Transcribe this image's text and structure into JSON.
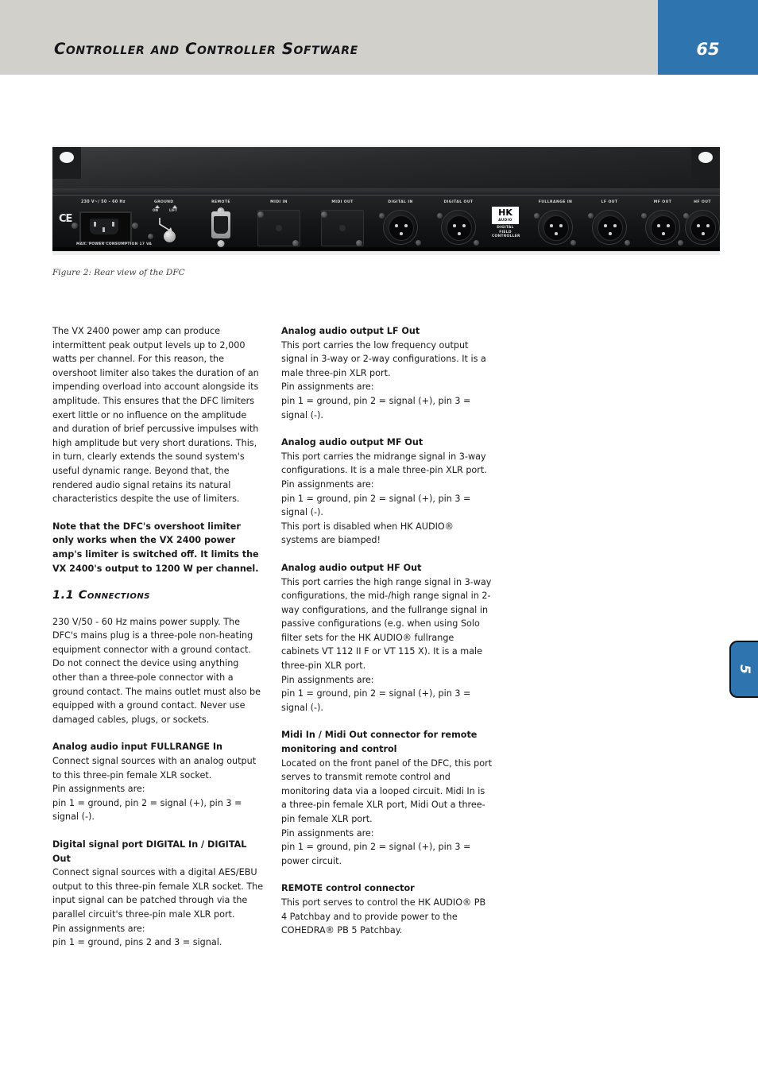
{
  "header": {
    "title": "Controller and Controller Software",
    "page_number": "65",
    "side_tab_label": "5",
    "accent_color": "#2e74af",
    "bar_color": "#d2d0cb"
  },
  "figure": {
    "caption": "Figure 2: Rear view of the DFC",
    "device": {
      "ce_mark": "CE",
      "mains_label": "230 V~/ 50 – 60 Hz",
      "consumption_label": "MAX. POWER CONSUMPTION 17 VA",
      "ground_label": "GROUND",
      "ground_option_on": "ON",
      "ground_option_lift": "LIFT",
      "brand_mark": "HK",
      "brand_mark_sub": "AUDIO",
      "brand_caption_line1": "DIGITAL",
      "brand_caption_line2": "FIELD",
      "brand_caption_line3": "CONTROLLER",
      "ports": [
        {
          "label": "REMOTE",
          "type": "dsub"
        },
        {
          "label": "MIDI IN",
          "type": "blank-plate"
        },
        {
          "label": "MIDI OUT",
          "type": "blank-plate"
        },
        {
          "label": "DIGITAL IN",
          "type": "xlr-female"
        },
        {
          "label": "DIGITAL OUT",
          "type": "xlr-male"
        },
        {
          "label": "FULLRANGE IN",
          "type": "xlr-female"
        },
        {
          "label": "LF OUT",
          "type": "xlr-male"
        },
        {
          "label": "MF OUT",
          "type": "xlr-male"
        },
        {
          "label": "HF OUT",
          "type": "xlr-male"
        }
      ]
    }
  },
  "left_column": {
    "intro_paragraph": "The VX 2400 power amp can produce intermittent peak output levels up to 2,000 watts per channel. For this reason, the overshoot limiter also takes the duration of an impending overload into account alongside its amplitude. This ensures that the DFC limiters exert little or no influence on the amplitude and duration of brief percussive impulses with high amplitude but very short durations. This, in turn, clearly extends the sound system's useful dynamic range. Beyond that, the rendered audio signal retains its natural characteristics despite the use of limiters.",
    "note_paragraph": "Note that the DFC's overshoot limiter only works when the VX 2400 power amp's limiter is switched off. It limits the VX 2400's output to 1200 W per channel.",
    "section_heading": "1.1 Connections",
    "mains_paragraph": "230 V/50 - 60 Hz mains power supply. The DFC's mains plug is a three-pole non-heating equipment connector with a ground contact. Do not connect the device using anything other than a three-pole connector with a ground contact. The mains outlet must also be equipped with a ground contact. Never use damaged cables, plugs, or sockets.",
    "fullrange_in": {
      "heading": "Analog audio input FULLRANGE In",
      "body": "Connect signal sources with an analog output to this three-pin female XLR socket.",
      "pin_intro": "Pin assignments are:",
      "pin_detail": "pin 1 = ground, pin 2 = signal (+), pin 3 = signal (-)."
    },
    "digital_port": {
      "heading": "Digital signal port DIGITAL In / DIGITAL Out",
      "body": "Connect signal sources with a digital AES/EBU output to this three-pin female XLR socket. The input signal can be patched through via the parallel circuit's three-pin male XLR port.",
      "pin_intro": "Pin assignments are:",
      "pin_detail": "pin 1 = ground, pins 2 and 3 = signal."
    }
  },
  "right_column": {
    "lf_out": {
      "heading": "Analog audio output LF Out",
      "body": "This port carries the low frequency output signal in 3-way or 2-way configurations. It is a male three-pin XLR port.",
      "pin_intro": "Pin assignments are:",
      "pin_detail": "pin 1 = ground, pin 2 = signal (+), pin 3 = signal (-)."
    },
    "mf_out": {
      "heading": "Analog audio output MF Out",
      "body": "This port carries the midrange signal in 3-way configurations. It is a male three-pin XLR port.",
      "pin_intro": "Pin assignments are:",
      "pin_detail": "pin 1 = ground, pin 2 = signal (+), pin 3 = signal (-).",
      "note": "This port is disabled when HK AUDIO® systems are biamped!"
    },
    "hf_out": {
      "heading": "Analog audio output HF Out",
      "body": "This port carries the high range signal in 3-way configurations, the mid-/high range signal in 2-way configurations, and the fullrange signal in passive configurations (e.g. when using Solo filter sets for the HK AUDIO® fullrange cabinets VT 112 II F or VT 115 X). It is a male three-pin XLR port.",
      "pin_intro": "Pin assignments are:",
      "pin_detail": "pin 1 = ground, pin 2 = signal (+), pin 3 = signal (-)."
    },
    "midi": {
      "heading": "Midi In / Midi Out connector for remote monitoring and control",
      "body": "Located on the front panel of the DFC, this port serves to transmit remote control and monitoring data via a looped circuit. Midi In is a three-pin female XLR port, Midi Out a three-pin female XLR port.",
      "pin_intro": "Pin assignments are:",
      "pin_detail": "pin 1 = ground, pin 2 = signal (+), pin 3 = power circuit."
    },
    "remote": {
      "heading": "REMOTE control connector",
      "body": "This port serves to control the HK AUDIO® PB 4 Patchbay and to provide power to the COHEDRA® PB 5 Patchbay."
    }
  }
}
